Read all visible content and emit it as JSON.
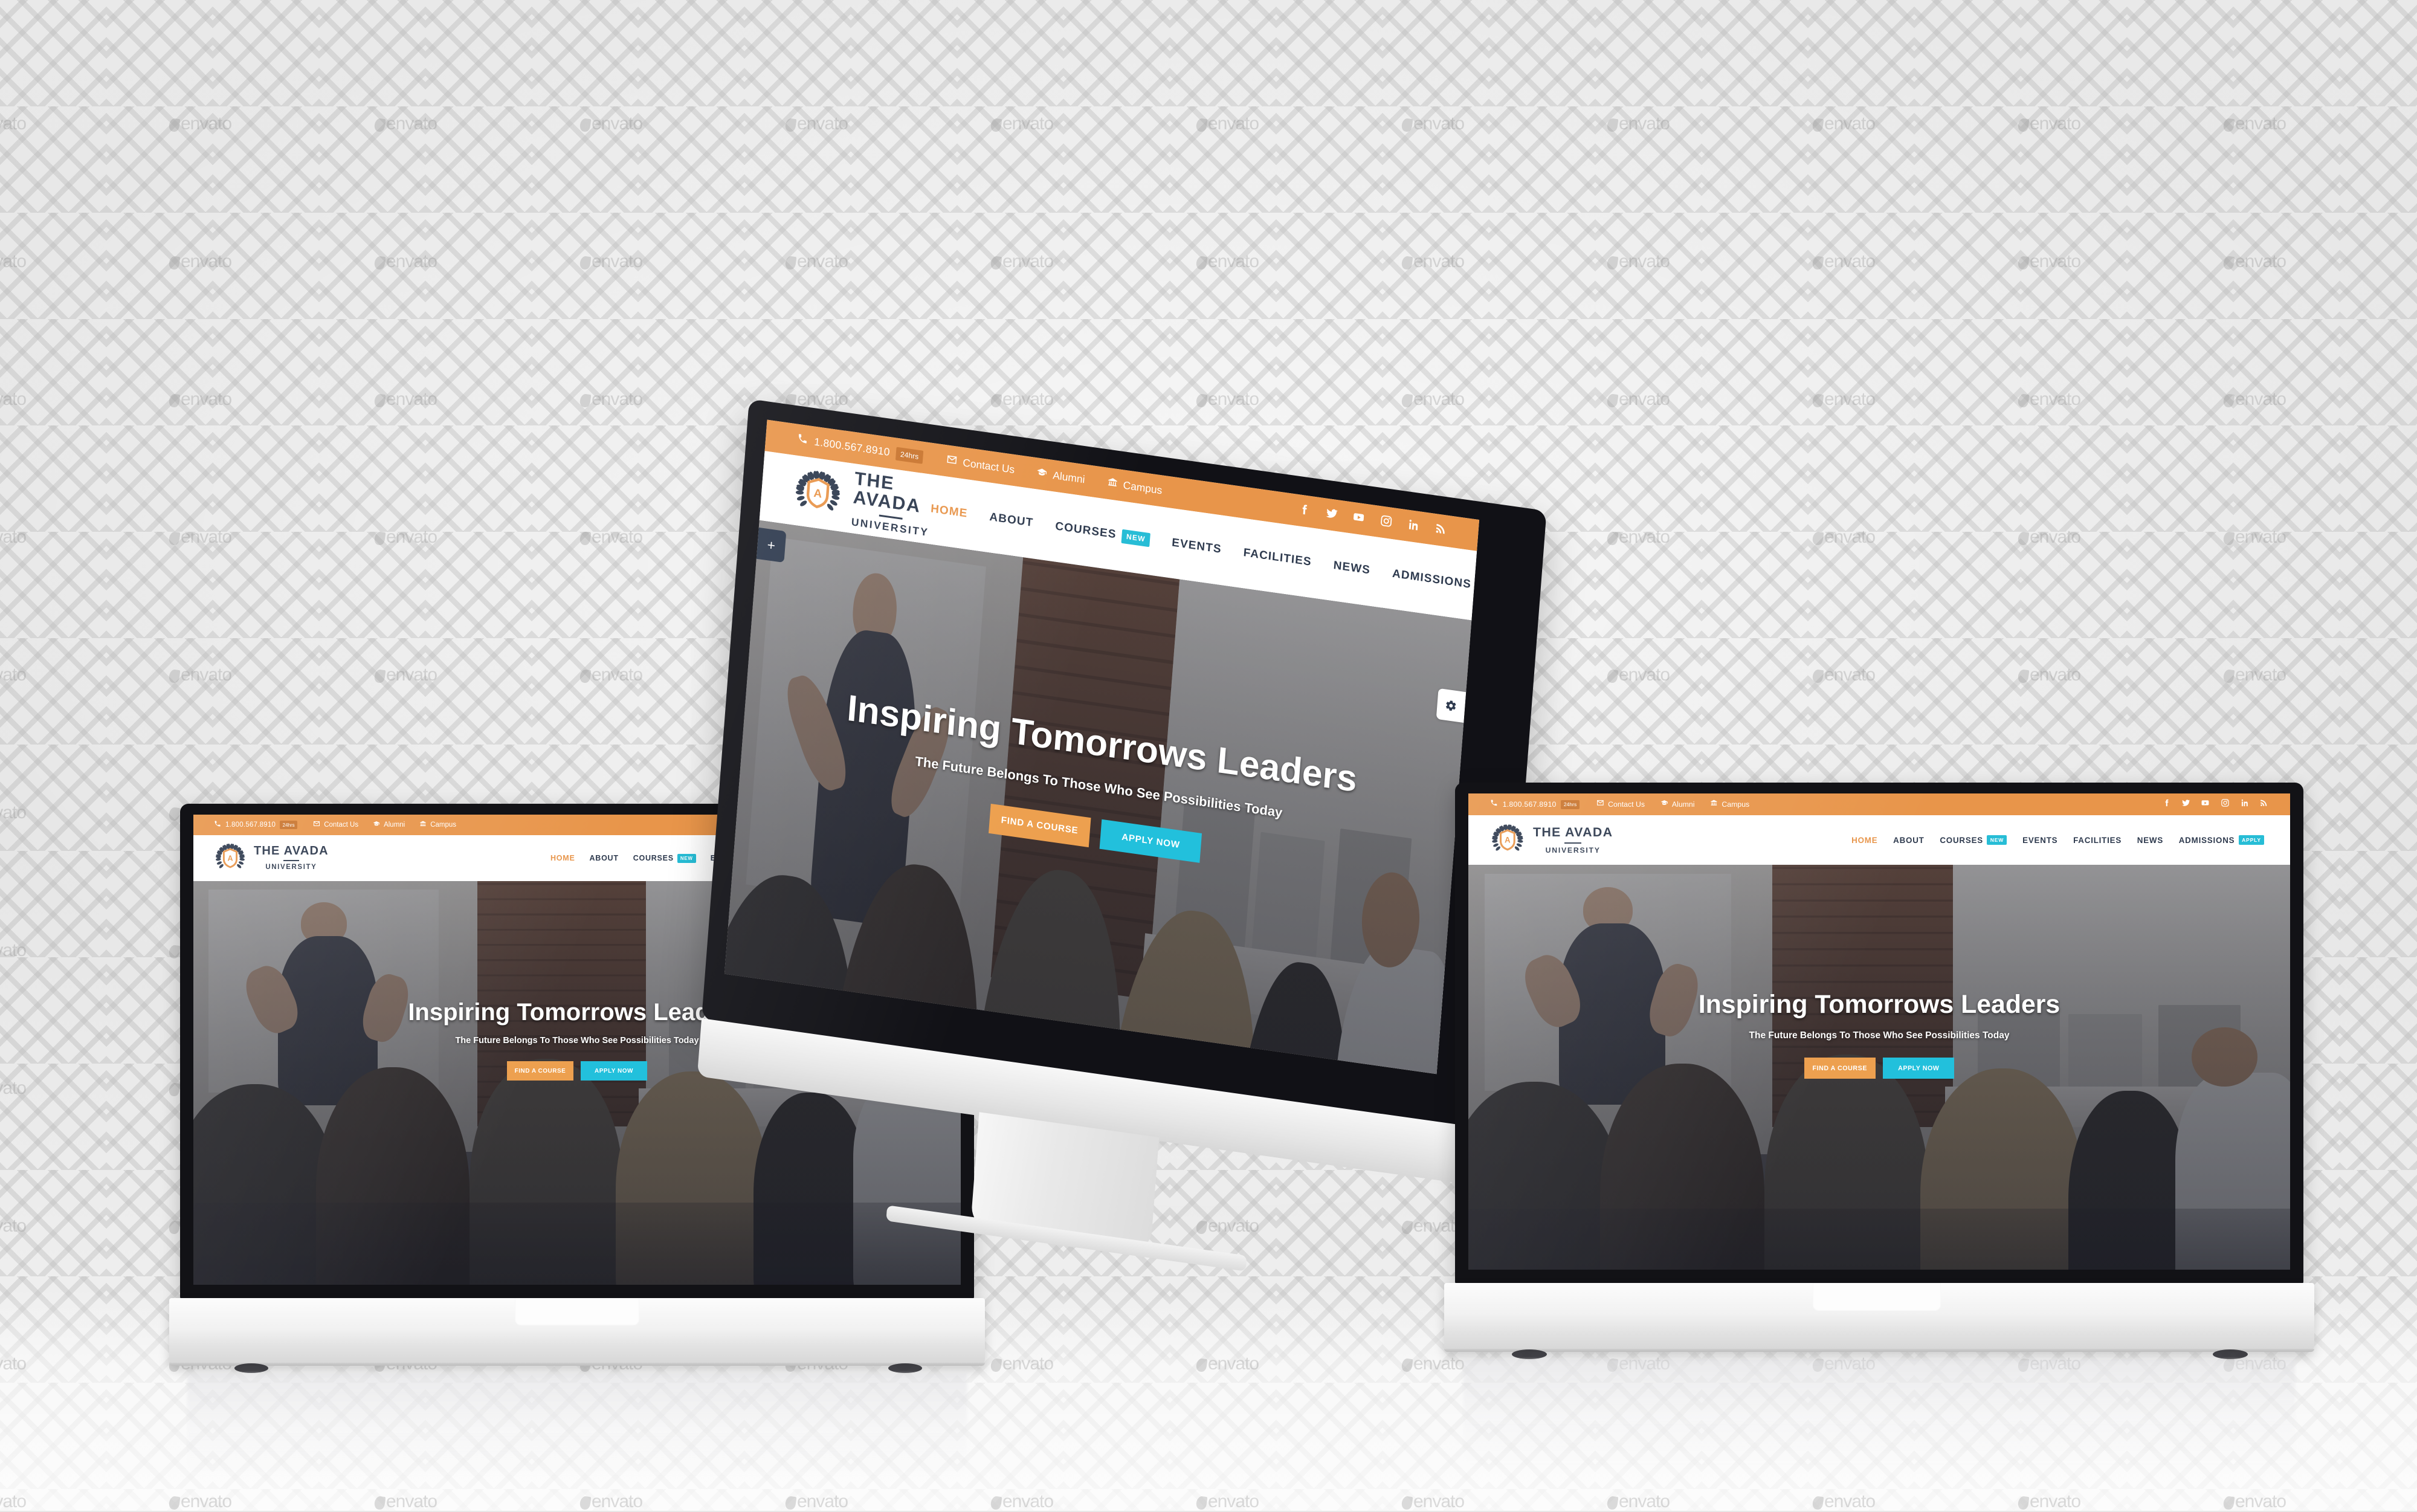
{
  "scene": {
    "background_color": "#e7e7e7",
    "watermark_text": "envato",
    "devices": [
      "macbook-left",
      "imac-center",
      "macbook-right"
    ]
  },
  "site": {
    "topbar": {
      "phone": "1.800.567.8910",
      "phone_badge": "24hrs",
      "links": [
        {
          "label": "Contact Us",
          "icon": "envelope-icon"
        },
        {
          "label": "Alumni",
          "icon": "graduation-cap-icon"
        },
        {
          "label": "Campus",
          "icon": "bank-icon"
        }
      ],
      "social": [
        {
          "name": "facebook-icon"
        },
        {
          "name": "twitter-icon"
        },
        {
          "name": "youtube-icon"
        },
        {
          "name": "instagram-icon"
        },
        {
          "name": "linkedin-icon"
        },
        {
          "name": "rss-icon"
        }
      ],
      "bg_color": "#e8954a",
      "badge_color": "#c9752e"
    },
    "brand": {
      "line1": "THE AVADA",
      "line2": "UNIVERSITY",
      "monogram": "A",
      "logo_icon": "laurel-wreath-shield-icon",
      "shield_color": "#e8954a",
      "text_color": "#2e3a4e"
    },
    "menu": {
      "active": "HOME",
      "items": [
        {
          "label": "HOME",
          "badge": ""
        },
        {
          "label": "ABOUT",
          "badge": ""
        },
        {
          "label": "COURSES",
          "badge": "NEW"
        },
        {
          "label": "EVENTS",
          "badge": ""
        },
        {
          "label": "FACILITIES",
          "badge": ""
        },
        {
          "label": "NEWS",
          "badge": ""
        },
        {
          "label": "ADMISSIONS",
          "badge": "APPLY"
        }
      ],
      "active_color": "#e8954a",
      "badge_color": "#27bdd6"
    },
    "hero": {
      "title": "Inspiring Tomorrows Leaders",
      "subtitle": "The Future Belongs To Those Who See Possibilities Today",
      "buttons": [
        {
          "label": "FIND A COURSE",
          "color": "#eda04f"
        },
        {
          "label": "APPLY NOW",
          "color": "#22c0dc"
        }
      ],
      "image_alt": "lecturer presenting to a classroom of students"
    },
    "side_tabs": [
      {
        "name": "add-tab",
        "glyph": "+",
        "color": "#2e3a4e"
      },
      {
        "name": "settings-tab",
        "glyph": "gear",
        "color": "#ffffff"
      }
    ]
  }
}
